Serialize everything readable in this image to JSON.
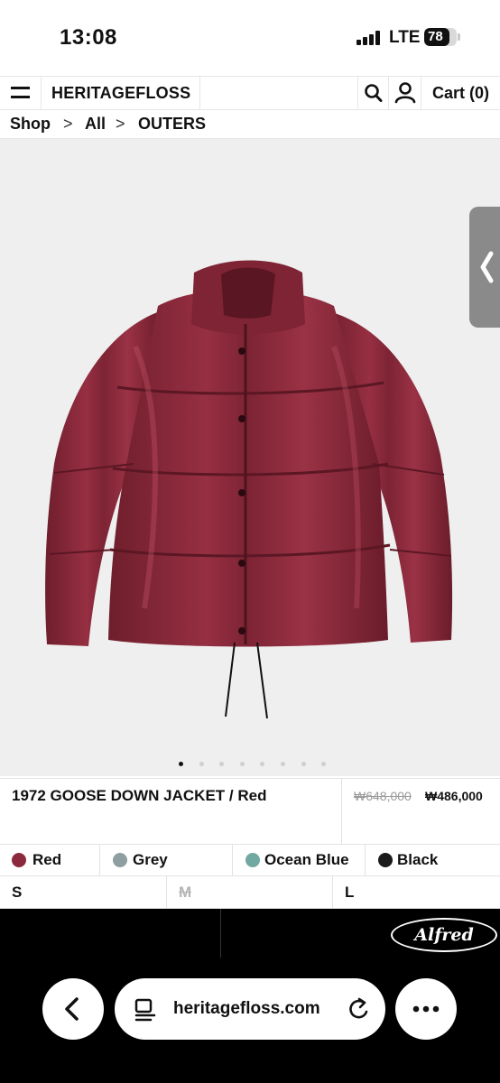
{
  "status_bar": {
    "time": "13:08",
    "network": "LTE",
    "battery": "78",
    "battery_level": 0.78
  },
  "header": {
    "brand": "HERITAGEFLOSS",
    "cart_label": "Cart (0)",
    "icons": {
      "menu": "menu-icon",
      "search": "search-icon",
      "account": "user-icon"
    }
  },
  "breadcrumb": {
    "items": [
      "Shop",
      "All",
      "OUTERS"
    ],
    "separator": ">"
  },
  "product": {
    "name": "1972 GOOSE DOWN JACKET / Red",
    "original_price": "₩648,000",
    "sale_price": "₩486,000",
    "image_count": 8,
    "active_image_index": 0,
    "colors": [
      {
        "label": "Red",
        "swatch": "#8c2a3d"
      },
      {
        "label": "Grey",
        "swatch": "#8f9ea0"
      },
      {
        "label": "Ocean Blue",
        "swatch": "#72a8a2"
      },
      {
        "label": "Black",
        "swatch": "#1a1a1a"
      }
    ],
    "sizes": [
      {
        "label": "S",
        "available": true
      },
      {
        "label": "M",
        "available": false
      },
      {
        "label": "L",
        "available": true
      }
    ]
  },
  "banner": {
    "logo_text": "Alfred"
  },
  "browser": {
    "url": "heritagefloss.com",
    "icons": {
      "back": "back-arrow-icon",
      "page": "page-menu-icon",
      "reload": "reload-icon",
      "more": "more-icon"
    }
  }
}
